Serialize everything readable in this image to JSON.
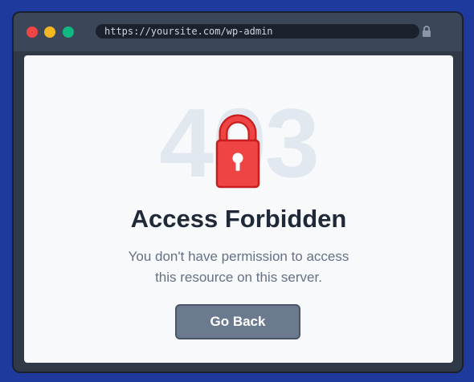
{
  "browser": {
    "url": "https://yoursite.com/wp-admin",
    "traffic_lights": {
      "close": "#ef4444",
      "minimize": "#f5b81e",
      "zoom": "#10b981"
    }
  },
  "error": {
    "code": "403",
    "title": "Access Forbidden",
    "message": "You don't have permission to access this resource on this server.",
    "button_label": "Go Back",
    "icon": "padlock-icon"
  },
  "colors": {
    "page_background": "#1e3a9c",
    "lock_red": "#ef4444",
    "button": "#6b7a8f"
  }
}
